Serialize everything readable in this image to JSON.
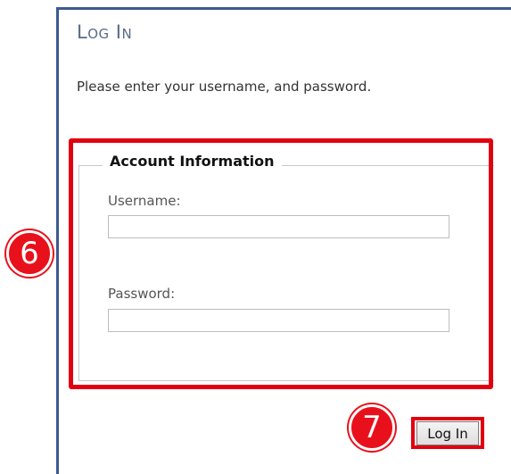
{
  "header": {
    "title": "Log In"
  },
  "instructions": "Please enter your username, and password.",
  "account": {
    "legend": "Account Information",
    "username_label": "Username:",
    "username_value": "",
    "password_label": "Password:",
    "password_value": ""
  },
  "actions": {
    "login_label": "Log In"
  },
  "callouts": {
    "fields_step": "6",
    "button_step": "7"
  },
  "colors": {
    "frame": "#3b5a8f",
    "highlight": "#e20010",
    "callout": "#e8111b"
  }
}
